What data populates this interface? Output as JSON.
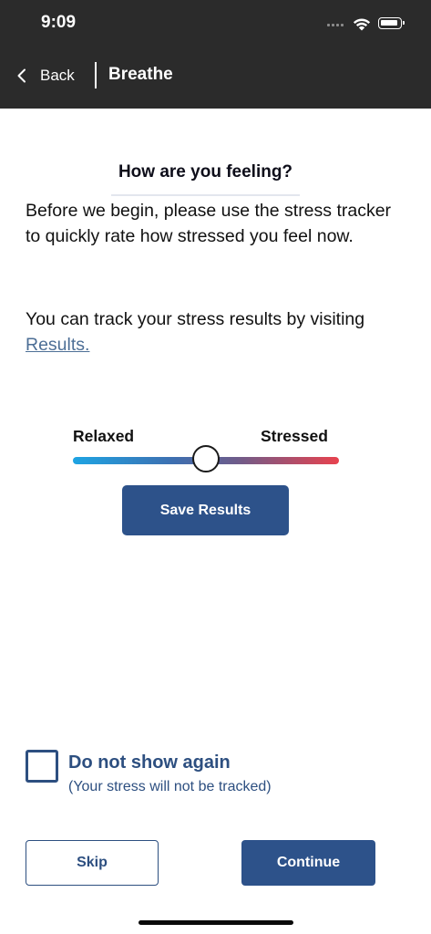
{
  "status_bar": {
    "time": "9:09",
    "icons": [
      "signal-icon",
      "wifi-icon",
      "battery-icon"
    ]
  },
  "nav": {
    "back_label": "Back",
    "title": "Breathe"
  },
  "content": {
    "heading": "How are you feeling?",
    "intro": "Before we begin, please use the stress tracker to quickly rate how stressed you feel now.",
    "track_prefix": "You can track your stress results by visiting",
    "results_link": "Results."
  },
  "slider": {
    "min_label": "Relaxed",
    "max_label": "Stressed",
    "value": 0.5
  },
  "buttons": {
    "save": "Save Results",
    "skip": "Skip",
    "continue": "Continue"
  },
  "do_not_show": {
    "label": "Do not show again",
    "sublabel": "(Your stress will not be tracked)",
    "checked": false
  },
  "colors": {
    "topbar": "#2b2b2b",
    "primary": "#2d528a",
    "link": "#4d6f96",
    "gradient_start": "#1ea4e3",
    "gradient_end": "#e8424e"
  }
}
